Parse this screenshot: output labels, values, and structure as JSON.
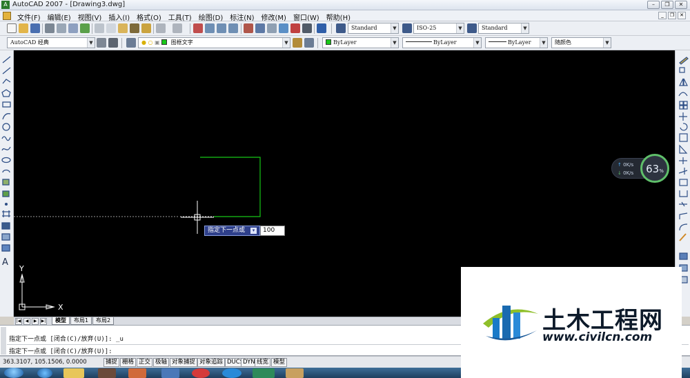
{
  "window": {
    "title": "AutoCAD 2007 - [Drawing3.dwg]",
    "app_icon_label": "A",
    "controls": [
      "minimize",
      "restore",
      "close"
    ]
  },
  "menu": {
    "items": [
      "文件(F)",
      "编辑(E)",
      "视图(V)",
      "插入(I)",
      "格式(O)",
      "工具(T)",
      "绘图(D)",
      "标注(N)",
      "修改(M)",
      "窗口(W)",
      "帮助(H)"
    ]
  },
  "toolbar1": {
    "text_style": "Standard",
    "dim_style": "ISO-25",
    "table_style": "Standard"
  },
  "toolbar2": {
    "workspace": "AutoCAD 经典",
    "layer_name": "图框文字",
    "color": "ByLayer",
    "linetype": "ByLayer",
    "lineweight": "ByLayer",
    "plot_style": "随颜色",
    "layer_color": "#19c819"
  },
  "drawing": {
    "ucs_x_label": "X",
    "ucs_y_label": "Y",
    "line_color": "#16c816",
    "dynamic_prompt": "指定下一点或",
    "dynamic_value": "100"
  },
  "tabs": {
    "items": [
      "模型",
      "布局1",
      "布局2"
    ],
    "active": "模型"
  },
  "command": {
    "history_line": "指定下一点或 [闭合(C)/放弃(U)]: _u",
    "current_line": "指定下一点或 [闭合(C)/放弃(U)]:"
  },
  "status": {
    "coordinates": "363.3107, 105.1506, 0.0000",
    "buttons": [
      "捕捉",
      "栅格",
      "正交",
      "极轴",
      "对象捕捉",
      "对象追踪",
      "DUCS",
      "DYN",
      "线宽",
      "模型"
    ]
  },
  "speed_widget": {
    "upload": "0K/s",
    "download": "0K/s",
    "percent": "63",
    "percent_unit": "%"
  },
  "watermark": {
    "title": "土木工程网",
    "url": "www.civilcn.com"
  }
}
